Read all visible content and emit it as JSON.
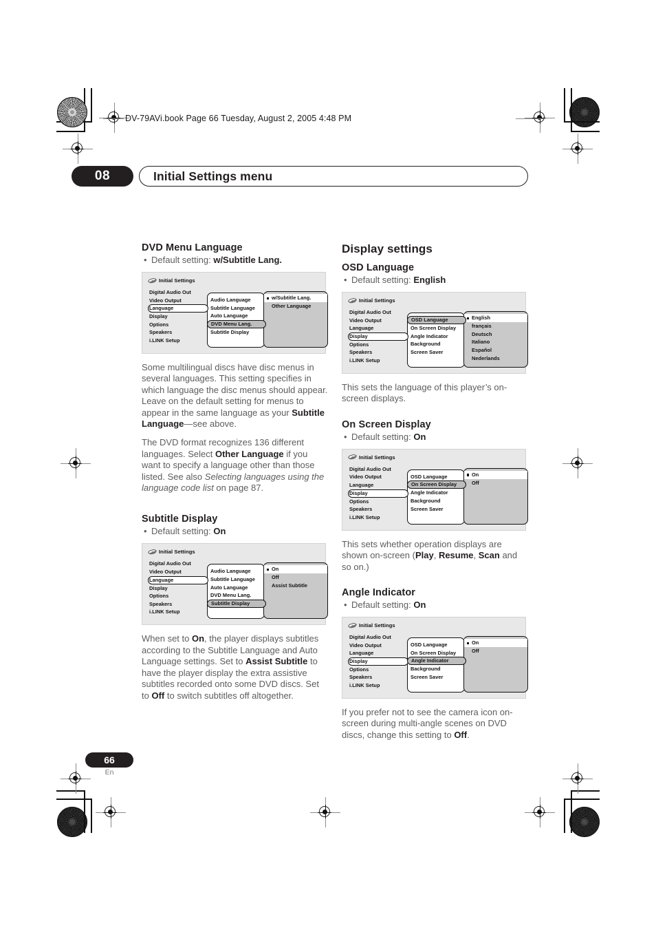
{
  "header": {
    "file_line": "DV-79AVi.book  Page 66  Tuesday, August 2, 2005  4:48 PM"
  },
  "chapter": {
    "number": "08",
    "title": "Initial Settings menu"
  },
  "footer": {
    "page_number": "66",
    "language_code": "En"
  },
  "osd_common": {
    "window_title": "Initial Settings",
    "disc_icon": "disc-icon",
    "level1_items": [
      "Digital Audio Out",
      "Video Output",
      "Language",
      "Display",
      "Options",
      "Speakers",
      "i.LINK Setup"
    ]
  },
  "left_column": {
    "sections": [
      {
        "heading": "DVD Menu Language",
        "default_label": "Default setting:",
        "default_value": "w/Subtitle Lang.",
        "osd": {
          "title": "Initial Settings",
          "level1": [
            {
              "label": "Digital Audio Out",
              "selected": false
            },
            {
              "label": "Video Output",
              "selected": false
            },
            {
              "label": "Language",
              "selected": true
            },
            {
              "label": "Display",
              "selected": false
            },
            {
              "label": "Options",
              "selected": false
            },
            {
              "label": "Speakers",
              "selected": false
            },
            {
              "label": "i.LINK Setup",
              "selected": false
            }
          ],
          "level2": [
            {
              "label": "Audio Language",
              "selected": false
            },
            {
              "label": "Subtitle Language",
              "selected": false
            },
            {
              "label": "Auto Language",
              "selected": false
            },
            {
              "label": "DVD Menu Lang.",
              "selected": true
            },
            {
              "label": "Subtitle Display",
              "selected": false
            }
          ],
          "level3": [
            {
              "label": "w/Subtitle Lang.",
              "selected": true
            },
            {
              "label": "Other Language",
              "selected": false
            }
          ]
        },
        "paragraphs": [
          "Some multilingual discs have disc menus in several languages. This setting specifies in which language the disc menus should appear. Leave on the default setting for menus to appear in the same language as your <b>Subtitle Language</b>—see above.",
          "The DVD format recognizes 136 different languages. Select <b>Other Language</b> if you want to specify a language other than those listed. See also <i>Selecting languages using the language code list</i> on page 87."
        ]
      },
      {
        "heading": "Subtitle Display",
        "default_label": "Default setting:",
        "default_value": "On",
        "osd": {
          "title": "Initial Settings",
          "level1": [
            {
              "label": "Digital Audio Out",
              "selected": false
            },
            {
              "label": "Video Output",
              "selected": false
            },
            {
              "label": "Language",
              "selected": true
            },
            {
              "label": "Display",
              "selected": false
            },
            {
              "label": "Options",
              "selected": false
            },
            {
              "label": "Speakers",
              "selected": false
            },
            {
              "label": "i.LINK Setup",
              "selected": false
            }
          ],
          "level2": [
            {
              "label": "Audio Language",
              "selected": false
            },
            {
              "label": "Subtitle Language",
              "selected": false
            },
            {
              "label": "Auto Language",
              "selected": false
            },
            {
              "label": "DVD Menu Lang.",
              "selected": false
            },
            {
              "label": "Subtitle Display",
              "selected": true
            }
          ],
          "level3": [
            {
              "label": "On",
              "selected": true
            },
            {
              "label": "Off",
              "selected": false
            },
            {
              "label": "Assist Subtitle",
              "selected": false
            }
          ]
        },
        "paragraphs": [
          "When set to <b>On</b>, the player displays subtitles according to the Subtitle Language and Auto Language settings. Set to <b>Assist Subtitle</b> to have the player display the extra assistive subtitles recorded onto some DVD discs. Set to <b>Off</b> to switch subtitles off altogether."
        ]
      }
    ]
  },
  "right_column": {
    "main_heading": "Display settings",
    "sections": [
      {
        "heading": "OSD Language",
        "default_label": "Default setting:",
        "default_value": "English",
        "osd": {
          "title": "Initial Settings",
          "level1": [
            {
              "label": "Digital Audio Out",
              "selected": false
            },
            {
              "label": "Video Output",
              "selected": false
            },
            {
              "label": "Language",
              "selected": false
            },
            {
              "label": "Display",
              "selected": true
            },
            {
              "label": "Options",
              "selected": false
            },
            {
              "label": "Speakers",
              "selected": false
            },
            {
              "label": "i.LINK Setup",
              "selected": false
            }
          ],
          "level2": [
            {
              "label": "OSD Language",
              "selected": true
            },
            {
              "label": "On Screen Display",
              "selected": false
            },
            {
              "label": "Angle Indicator",
              "selected": false
            },
            {
              "label": "Background",
              "selected": false
            },
            {
              "label": "Screen Saver",
              "selected": false
            }
          ],
          "level3": [
            {
              "label": "English",
              "selected": true
            },
            {
              "label": "français",
              "selected": false
            },
            {
              "label": "Deutsch",
              "selected": false
            },
            {
              "label": "Italiano",
              "selected": false
            },
            {
              "label": "Español",
              "selected": false
            },
            {
              "label": "Nederlands",
              "selected": false
            }
          ]
        },
        "paragraphs": [
          "This sets the language of this player’s on-screen displays."
        ]
      },
      {
        "heading": "On Screen Display",
        "default_label": "Default setting:",
        "default_value": "On",
        "osd": {
          "title": "Initial Settings",
          "level1": [
            {
              "label": "Digital Audio Out",
              "selected": false
            },
            {
              "label": "Video Output",
              "selected": false
            },
            {
              "label": "Language",
              "selected": false
            },
            {
              "label": "Display",
              "selected": true
            },
            {
              "label": "Options",
              "selected": false
            },
            {
              "label": "Speakers",
              "selected": false
            },
            {
              "label": "i.LINK Setup",
              "selected": false
            }
          ],
          "level2": [
            {
              "label": "OSD Language",
              "selected": false
            },
            {
              "label": "On Screen Display",
              "selected": true
            },
            {
              "label": "Angle Indicator",
              "selected": false
            },
            {
              "label": "Background",
              "selected": false
            },
            {
              "label": "Screen Saver",
              "selected": false
            }
          ],
          "level3": [
            {
              "label": "On",
              "selected": true
            },
            {
              "label": "Off",
              "selected": false
            }
          ]
        },
        "paragraphs": [
          "This sets whether operation displays are shown on-screen (<b>Play</b>, <b>Resume</b>, <b>Scan</b> and so on.)"
        ]
      },
      {
        "heading": "Angle Indicator",
        "default_label": "Default setting:",
        "default_value": "On",
        "osd": {
          "title": "Initial Settings",
          "level1": [
            {
              "label": "Digital Audio Out",
              "selected": false
            },
            {
              "label": "Video Output",
              "selected": false
            },
            {
              "label": "Language",
              "selected": false
            },
            {
              "label": "Display",
              "selected": true
            },
            {
              "label": "Options",
              "selected": false
            },
            {
              "label": "Speakers",
              "selected": false
            },
            {
              "label": "i.LINK Setup",
              "selected": false
            }
          ],
          "level2": [
            {
              "label": "OSD Language",
              "selected": false
            },
            {
              "label": "On Screen Display",
              "selected": false
            },
            {
              "label": "Angle Indicator",
              "selected": true
            },
            {
              "label": "Background",
              "selected": false
            },
            {
              "label": "Screen Saver",
              "selected": false
            }
          ],
          "level3": [
            {
              "label": "On",
              "selected": true
            },
            {
              "label": "Off",
              "selected": false
            }
          ]
        },
        "paragraphs": [
          "If you prefer not to see the camera icon on-screen during multi-angle scenes on DVD discs, change this setting to <b>Off</b>."
        ]
      }
    ]
  }
}
